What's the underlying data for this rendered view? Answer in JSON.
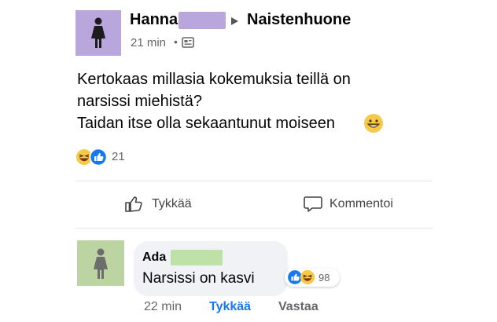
{
  "post": {
    "author": "Hanna",
    "group": "Naistenhuone",
    "time": "21 min",
    "dot": "•",
    "body_lines": [
      "Kertokaas millasia kokemuksia teillä on",
      "narsissi miehistä?",
      "Taidan itse olla sekaantunut moiseen"
    ],
    "reaction_count": "21",
    "like_label": "Tykkää",
    "comment_label": "Kommentoi"
  },
  "comment": {
    "author": "Ada",
    "text": "Narsissi on kasvi",
    "reaction_count": "98",
    "time": "22 min",
    "like_label": "Tykkää",
    "reply_label": "Vastaa"
  },
  "colors": {
    "avatar_post": "#b9a6dd",
    "avatar_comment": "#bcd4a2",
    "link_blue": "#1877f2",
    "meta_gray": "#65676b"
  },
  "icons": [
    "person-silhouette-icon",
    "caret-right-icon",
    "group-privacy-icon",
    "laughing-emoji-icon",
    "like-reaction-icon",
    "thumbs-up-icon",
    "comment-bubble-icon",
    "grinning-emoji-icon"
  ]
}
